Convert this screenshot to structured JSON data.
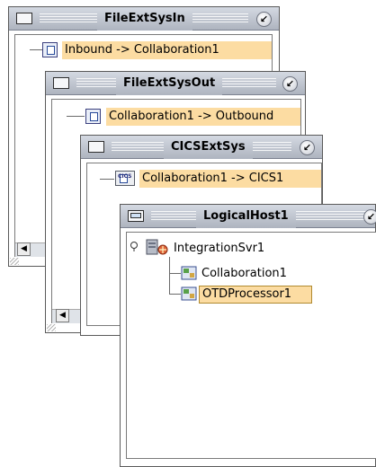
{
  "windows": {
    "file_in": {
      "title": "FileExtSysIn",
      "node_label": "Inbound -> Collaboration1"
    },
    "file_out": {
      "title": "FileExtSysOut",
      "node_label": "Collaboration1 -> Outbound"
    },
    "cics": {
      "title": "CICSExtSys",
      "icon_text": "CICS",
      "node_label": "Collaboration1 -> CICS1"
    },
    "host": {
      "title": "LogicalHost1",
      "server_label": "IntegrationSvr1",
      "children": [
        "Collaboration1",
        "OTDProcessor1"
      ]
    }
  },
  "controls": {
    "minimize_glyph": "↙",
    "scroll_left_glyph": "◀"
  }
}
